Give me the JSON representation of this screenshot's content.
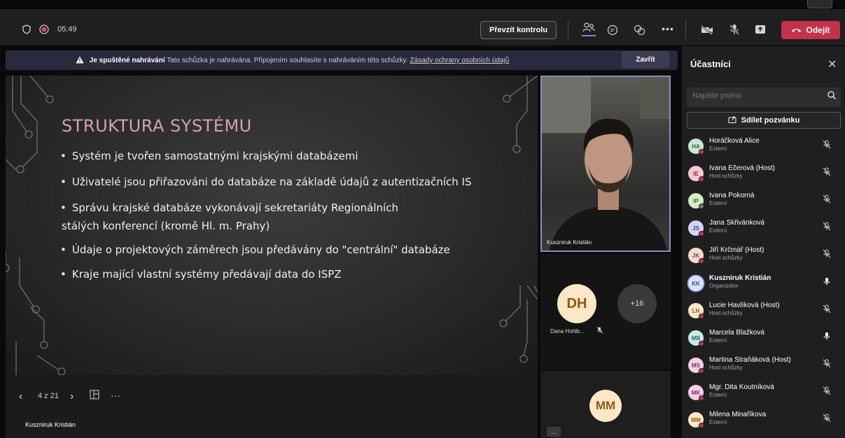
{
  "topbar": {
    "timer": "05:49",
    "take_control_label": "Převzít kontrolu",
    "leave_label": "Odejít"
  },
  "banner": {
    "title": "Je spuštěné nahrávání",
    "text": "Tato schůzka je nahrávána. Připojením souhlasíte s nahráváním této schůzky.",
    "link": "Zásady ochrany osobních údajů",
    "close_label": "Zavřít"
  },
  "slide": {
    "title": "STRUKTURA SYSTÉMU",
    "bullets": [
      "Systém je tvořen samostatnými krajskými databázemi",
      "Uživatelé jsou přiřazováni do databáze na základě údajů z autentizačních IS",
      "Správu krajské databáze vykonávají sekretariáty Regionálních",
      "stálých konferencí (kromě Hl. m. Prahy)",
      "Údaje o projektových záměrech jsou předávány do \"centrální\" databáze",
      "Kraje mající vlastní systémy předávají data do ISPZ"
    ]
  },
  "slide_controls": {
    "page": "4 z 21",
    "presenter": "Kuszniruk Kristián"
  },
  "video": {
    "name": "Kuszniruk Kristián"
  },
  "gallery": {
    "dh_initials": "DH",
    "dh_name": "Dana Hohlb...",
    "plus_count": "+16",
    "mm_initials": "MM",
    "more": "..."
  },
  "panel": {
    "title": "Účastníci",
    "search_placeholder": "Napište jméno",
    "invite_label": "Sdílet pozvánku",
    "participants": [
      {
        "initials": "HA",
        "name": "Horáčková Alice",
        "role": "Externí",
        "color": "#c8e6d3",
        "text": "#2f6b45",
        "mic": "muted"
      },
      {
        "initials": "IE",
        "name": "Ivana Ečerová (Host)",
        "role": "Host schůzky",
        "color": "#f6c8cf",
        "text": "#8a2a3a",
        "mic": "muted"
      },
      {
        "initials": "IP",
        "name": "Ivana Pokorná",
        "role": "Externí",
        "color": "#d7ecc7",
        "text": "#3f6b2a",
        "mic": "muted"
      },
      {
        "initials": "JS",
        "name": "Jana Skřivánková",
        "role": "Externí",
        "color": "#d6d2f2",
        "text": "#4a3f8a",
        "mic": "muted"
      },
      {
        "initials": "JK",
        "name": "Jiří Krčmář (Host)",
        "role": "Host schůzky",
        "color": "#f1dcd0",
        "text": "#7a4a2f",
        "mic": "muted"
      },
      {
        "initials": "KK",
        "name": "Kuszniruk Kristián",
        "role": "Organizátor",
        "color": "#d6e4f6",
        "text": "#2f4f7a",
        "mic": "on"
      },
      {
        "initials": "LH",
        "name": "Lucie Havlíková (Host)",
        "role": "Host schůzky",
        "color": "#fde7c6",
        "text": "#8a5a13",
        "mic": "muted"
      },
      {
        "initials": "MB",
        "name": "Marcela Blažková",
        "role": "Externí",
        "color": "#c8ebea",
        "text": "#2a6b69",
        "mic": "on"
      },
      {
        "initials": "MS",
        "name": "Martina Straňáková (Host)",
        "role": "Host schůzky",
        "color": "#f4d0e6",
        "text": "#7a2f5e",
        "mic": "muted"
      },
      {
        "initials": "MK",
        "name": "Mgr. Dita Koutníková",
        "role": "Externí",
        "color": "#f4d0e6",
        "text": "#7a2f5e",
        "mic": "muted"
      },
      {
        "initials": "MM",
        "name": "Milena Minaříkova",
        "role": "Externí",
        "color": "#fde7c6",
        "text": "#8a5a13",
        "mic": "muted"
      }
    ]
  }
}
